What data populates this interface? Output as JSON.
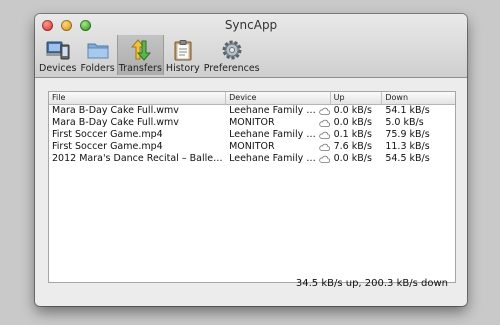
{
  "window": {
    "title": "SyncApp"
  },
  "toolbar": [
    {
      "label": "Devices",
      "icon": "devices-icon"
    },
    {
      "label": "Folders",
      "icon": "folder-icon"
    },
    {
      "label": "Transfers",
      "icon": "transfers-icon",
      "selected": true
    },
    {
      "label": "History",
      "icon": "history-icon"
    },
    {
      "label": "Preferences",
      "icon": "gear-icon"
    }
  ],
  "table": {
    "columns": {
      "file": "File",
      "device": "Device",
      "up": "Up",
      "down": "Down"
    },
    "rows": [
      {
        "file": "Mara B-Day Cake Full.wmv",
        "device": "Leehane Family i…",
        "up": "0.0 kB/s",
        "down": "54.1 kB/s"
      },
      {
        "file": "Mara B-Day Cake Full.wmv",
        "device": "MONITOR",
        "up": "0.0 kB/s",
        "down": "5.0 kB/s"
      },
      {
        "file": "First Soccer Game.mp4",
        "device": "Leehane Family i…",
        "up": "0.1 kB/s",
        "down": "75.9 kB/s"
      },
      {
        "file": "First Soccer Game.mp4",
        "device": "MONITOR",
        "up": "7.6 kB/s",
        "down": "11.3 kB/s"
      },
      {
        "file": "2012 Mara's Dance Recital – Ballet…",
        "device": "Leehane Family i…",
        "up": "0.0 kB/s",
        "down": "54.5 kB/s"
      }
    ]
  },
  "status": {
    "text": "34.5 kB/s up, 200.3 kB/s down"
  }
}
